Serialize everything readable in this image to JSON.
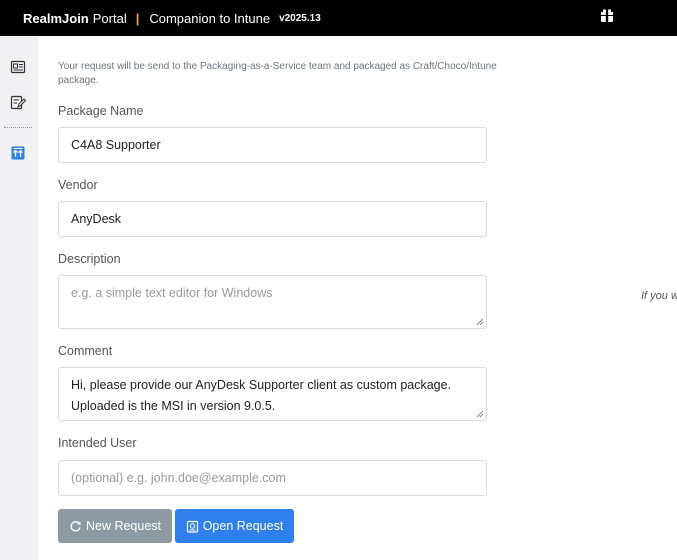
{
  "header": {
    "brand_bold": "RealmJoin",
    "brand_portal": "Portal",
    "separator": "|",
    "app_name": "Companion to Intune",
    "version": "v2025.13"
  },
  "sidebar": {
    "items": [
      {
        "icon": "id-card-icon"
      },
      {
        "icon": "edit-list-icon"
      },
      {
        "icon": "upload-icon",
        "active": true
      }
    ]
  },
  "form": {
    "intro": "Your request will be send to the Packaging-as-a-Service team and packaged as Craft/Choco/Intune package.",
    "package_name": {
      "label": "Package Name",
      "value": "C4A8 Supporter"
    },
    "vendor": {
      "label": "Vendor",
      "value": "AnyDesk"
    },
    "description": {
      "label": "Description",
      "value": "",
      "placeholder": "e.g. a simple text editor for Windows"
    },
    "comment": {
      "label": "Comment",
      "value": "Hi, please provide our AnyDesk Supporter client as custom package. Uploaded is the MSI in version 9.0.5."
    },
    "intended_user": {
      "label": "Intended User",
      "value": "",
      "placeholder": "(optional) e.g. john.doe@example.com"
    }
  },
  "buttons": {
    "new_request": "New Request",
    "open_request": "Open Request"
  },
  "side_note": "If you w",
  "colors": {
    "topbar": "#000000",
    "accent": "#2f80ed",
    "separator": "#f0a830",
    "sidebar": "#f1f1f3",
    "active_icon": "#2f80ed"
  }
}
